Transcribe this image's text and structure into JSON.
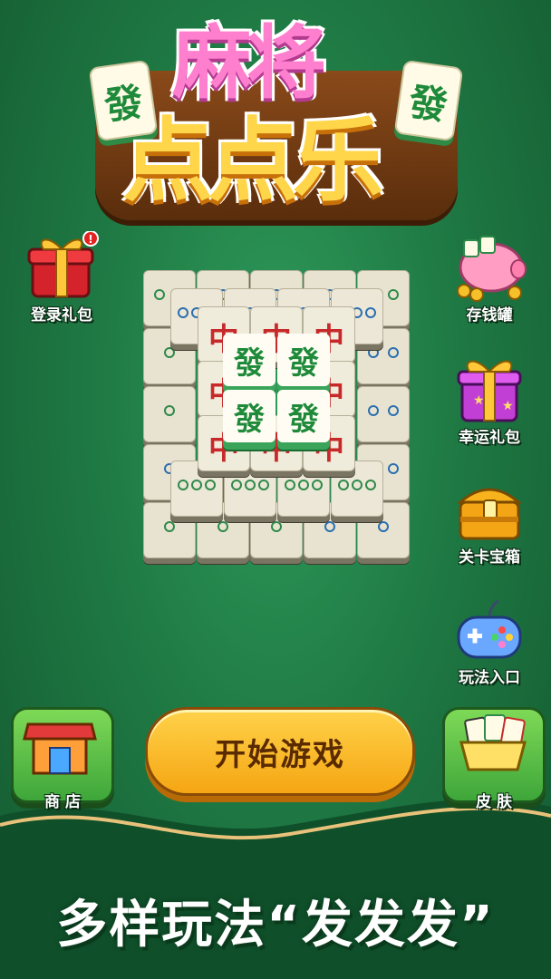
{
  "logo": {
    "line1": "麻将",
    "line2": "点点乐",
    "tile_char": "發"
  },
  "left_buttons": [
    {
      "label": "登录礼包",
      "icon": "gift-box-icon"
    }
  ],
  "right_buttons": [
    {
      "label": "存钱罐",
      "icon": "piggy-bank-icon"
    },
    {
      "label": "幸运礼包",
      "icon": "lucky-gift-icon"
    },
    {
      "label": "关卡宝箱",
      "icon": "treasure-chest-icon"
    },
    {
      "label": "玩法入口",
      "icon": "gamepad-icon"
    }
  ],
  "board": {
    "top_tiles": [
      "發",
      "發",
      "發",
      "發"
    ],
    "zhong_char": "中"
  },
  "start_button": {
    "label": "开始游戏"
  },
  "shop_button": {
    "label": "商 店"
  },
  "skin_button": {
    "label": "皮 肤"
  },
  "slogan": "多样玩法“发发发”",
  "colors": {
    "background": "#1f7a44",
    "start_button": "#f5a613",
    "logo_pink": "#ff7fcf",
    "logo_yellow": "#ffd54a"
  }
}
